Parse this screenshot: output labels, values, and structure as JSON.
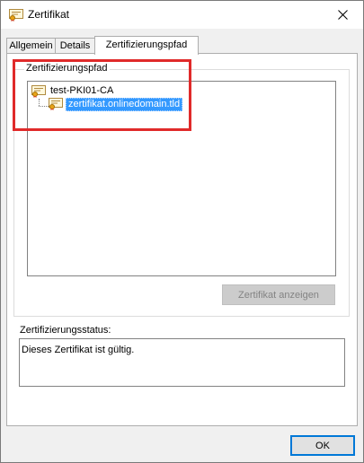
{
  "window": {
    "title": "Zertifikat"
  },
  "tabs": [
    {
      "label": "Allgemein",
      "active": false
    },
    {
      "label": "Details",
      "active": false
    },
    {
      "label": "Zertifizierungspfad",
      "active": true
    }
  ],
  "path_group": {
    "label": "Zertifizierungspfad",
    "nodes": [
      {
        "label": "test-PKI01-CA",
        "selected": false
      },
      {
        "label": "zertifikat.onlinedomain.tld",
        "selected": true
      }
    ],
    "view_button": "Zertifikat anzeigen"
  },
  "status": {
    "label": "Zertifizierungsstatus:",
    "text": "Dieses Zertifikat ist gültig."
  },
  "buttons": {
    "ok": "OK"
  },
  "colors": {
    "accent": "#0078d7",
    "selection": "#3399ff",
    "annotation": "#e02a2a"
  },
  "icons": {
    "cert": "certificate-icon",
    "close": "close-icon"
  }
}
